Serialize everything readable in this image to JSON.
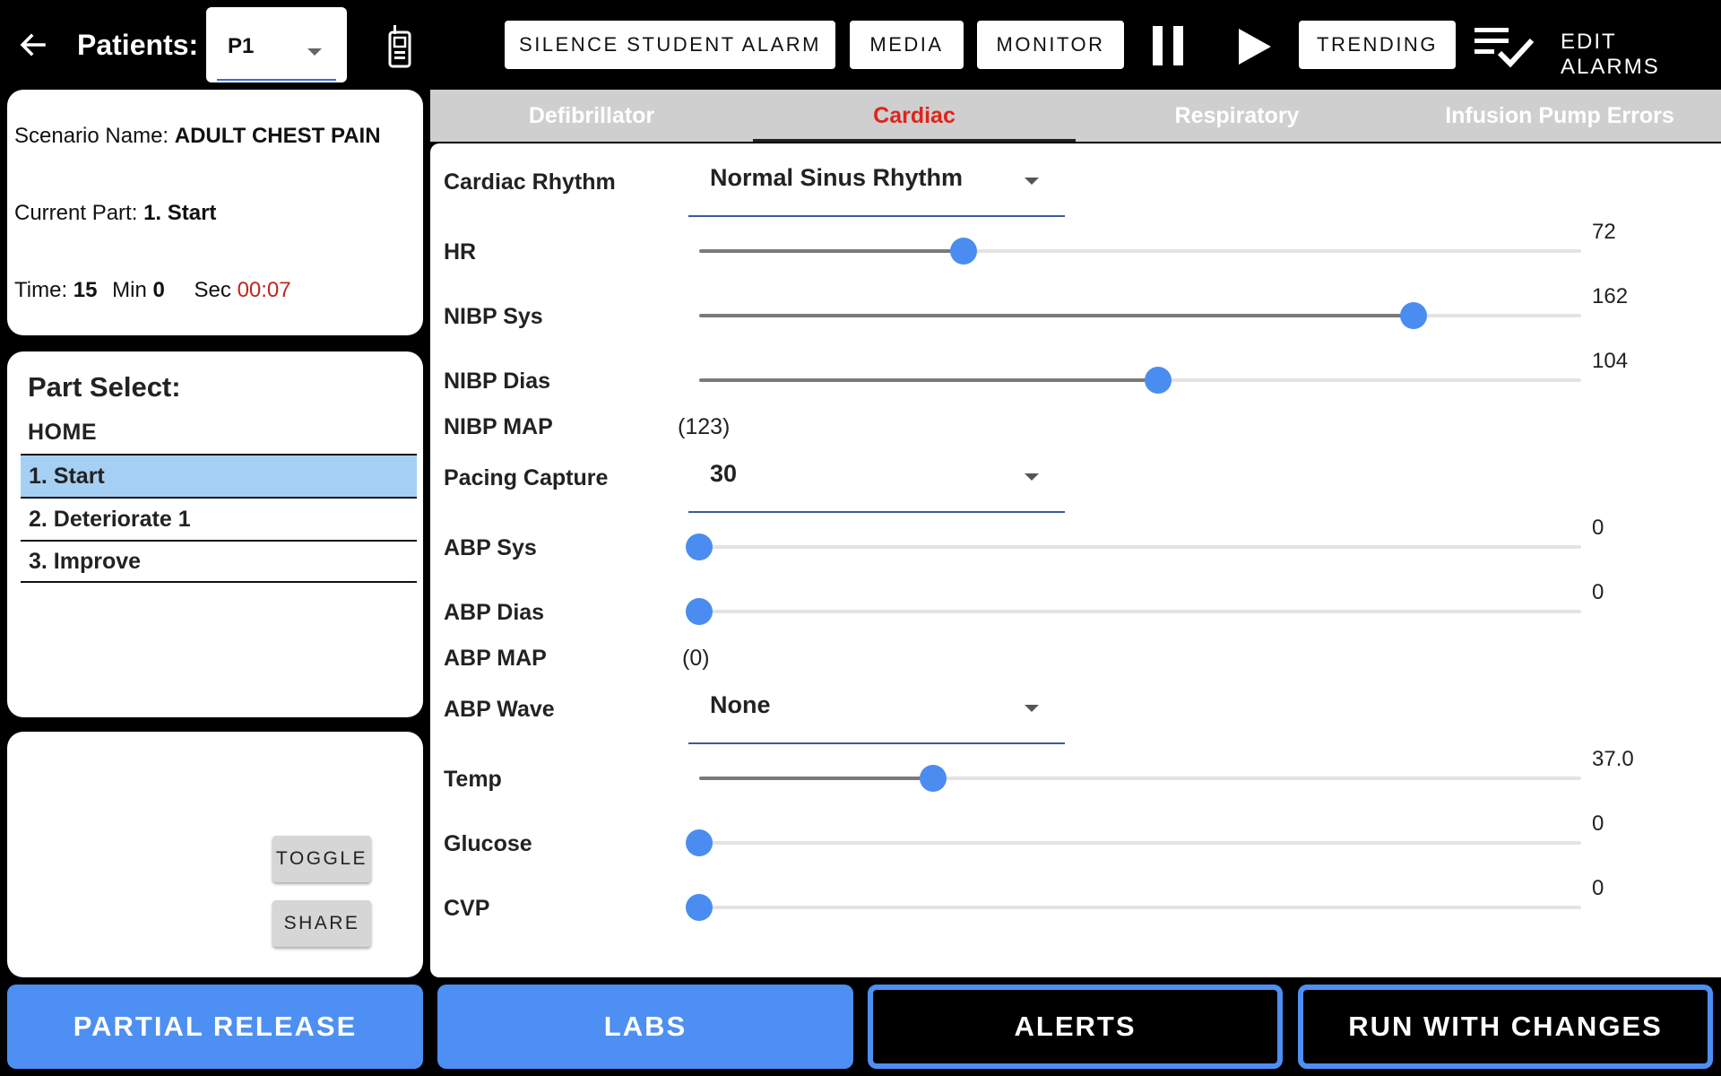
{
  "topbar": {
    "patients_label": "Patients:",
    "patient_selected": "P1",
    "buttons": {
      "silence": "SILENCE STUDENT ALARM",
      "media": "MEDIA",
      "monitor": "MONITOR",
      "trending": "TRENDING"
    },
    "edit_alarms": "EDIT ALARMS",
    "icons": [
      "back-arrow-icon",
      "radio-device-icon",
      "pause-icon",
      "play-icon",
      "checklist-icon"
    ]
  },
  "scenario": {
    "name_label": "Scenario Name:",
    "name_value": "ADULT CHEST PAIN",
    "part_label": "Current Part:",
    "part_value": "1. Start",
    "time_label": "Time:",
    "time_min_value": "15",
    "min_label": "Min",
    "time_sec_value": "0",
    "sec_label": "Sec",
    "elapsed": "00:07"
  },
  "part_select": {
    "title": "Part Select:",
    "home": "HOME",
    "items": [
      {
        "label": "1. Start",
        "selected": true
      },
      {
        "label": "2. Deteriorate 1",
        "selected": false
      },
      {
        "label": "3. Improve",
        "selected": false
      }
    ]
  },
  "tools": {
    "toggle": "TOGGLE",
    "share": "SHARE"
  },
  "tabs": [
    {
      "label": "Defibrillator",
      "active": false
    },
    {
      "label": "Cardiac",
      "active": true
    },
    {
      "label": "Respiratory",
      "active": false
    },
    {
      "label": "Infusion Pump Errors",
      "active": false
    }
  ],
  "cardiac": {
    "rhythm": {
      "label": "Cardiac Rhythm",
      "value": "Normal Sinus Rhythm"
    },
    "hr": {
      "label": "HR",
      "value": "72",
      "fraction": 0.3
    },
    "nibp_sys": {
      "label": "NIBP Sys",
      "value": "162",
      "fraction": 0.81
    },
    "nibp_dias": {
      "label": "NIBP Dias",
      "value": "104",
      "fraction": 0.52
    },
    "nibp_map": {
      "label": "NIBP MAP",
      "value": "(123)"
    },
    "pacing": {
      "label": "Pacing Capture",
      "value": "30"
    },
    "abp_sys": {
      "label": "ABP Sys",
      "value": "0",
      "fraction": 0.0
    },
    "abp_dias": {
      "label": "ABP Dias",
      "value": "0",
      "fraction": 0.0
    },
    "abp_map": {
      "label": "ABP MAP",
      "value": "(0)"
    },
    "abp_wave": {
      "label": "ABP Wave",
      "value": "None"
    },
    "temp": {
      "label": "Temp",
      "value": "37.0",
      "fraction": 0.265
    },
    "glucose": {
      "label": "Glucose",
      "value": "0",
      "fraction": 0.0
    },
    "cvp": {
      "label": "CVP",
      "value": "0",
      "fraction": 0.0
    }
  },
  "bottom": {
    "partial_release": "PARTIAL RELEASE",
    "labs": "LABS",
    "alerts": "ALERTS",
    "run_with_changes": "RUN WITH CHANGES"
  },
  "colors": {
    "accent_blue": "#4d8ff2",
    "active_tab_red": "#e0241b",
    "selected_row": "#a6d0f3",
    "slider_thumb": "#4b8cf0"
  }
}
